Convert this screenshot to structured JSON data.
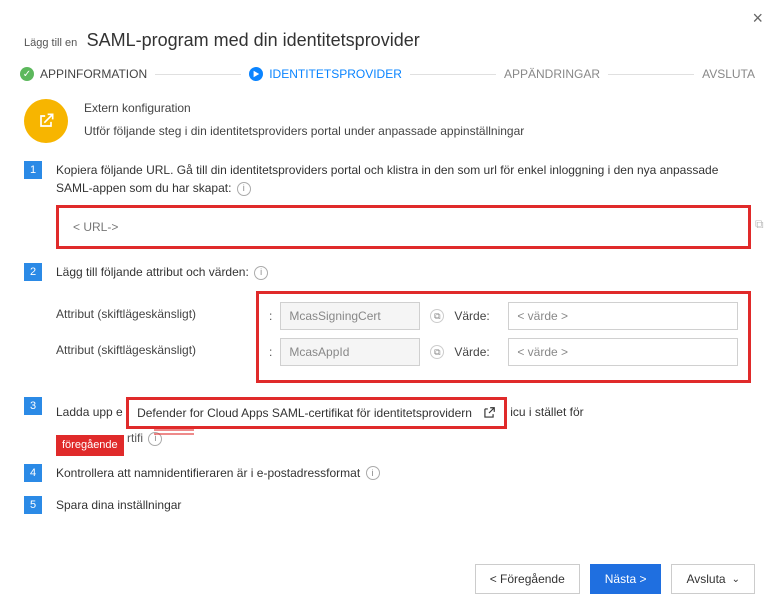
{
  "close_label": "×",
  "header": {
    "pre": "Lägg till en",
    "title": "SAML-program med din identitetsprovider"
  },
  "stepper": {
    "s1": "APPINFORMATION",
    "s2": "IDENTITETSPROVIDER",
    "s3": "APPÄNDRINGAR",
    "s4": "AVSLUTA"
  },
  "ext": {
    "title": "Extern konfiguration",
    "desc": "Utför följande steg i din identitetsproviders portal under anpassade appinställningar"
  },
  "step1": {
    "num": "1",
    "text": "Kopiera följande URL. Gå till din identitetsproviders portal och klistra in den som url för enkel inloggning i den nya anpassade SAML-appen som du har skapat:",
    "url": "< URL->"
  },
  "step2": {
    "num": "2",
    "text": "Lägg till följande attribut och värden:",
    "attr_label": "Attribut (skiftlägeskänsligt)",
    "colon": ":",
    "a1": "McasSigningCert",
    "a2": "McasAppId",
    "value_label": "Värde:",
    "v_placeholder": "< värde >"
  },
  "step3": {
    "num": "3",
    "pre": "Ladda upp e",
    "cert": "Defender for Cloud Apps SAML-certifikat för identitetsprovidern",
    "post": "icu i stället för",
    "red": "föregående",
    "tail": "rtifi"
  },
  "step4": {
    "num": "4",
    "text": "Kontrollera att namnidentifieraren är i e-postadressformat"
  },
  "step5": {
    "num": "5",
    "text": "Spara dina inställningar"
  },
  "footer": {
    "back": "< Föregående",
    "next": "Nästa >",
    "close": "Avsluta",
    "chev": "⌄"
  }
}
